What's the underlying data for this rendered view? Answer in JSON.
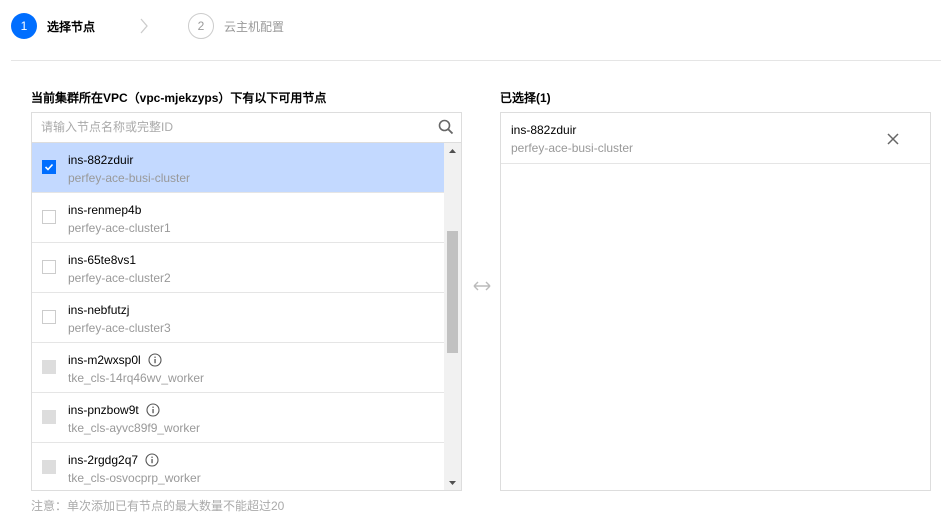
{
  "steps": [
    {
      "number": "1",
      "label": "选择节点",
      "active": true
    },
    {
      "number": "2",
      "label": "云主机配置",
      "active": false
    }
  ],
  "left": {
    "title": "当前集群所在VPC（vpc-mjekzyps）下有以下可用节点",
    "search_placeholder": "请输入节点名称或完整ID",
    "items": [
      {
        "name": "ins-882zduir",
        "sub": "perfey-ace-busi-cluster",
        "state": "checked",
        "info": false
      },
      {
        "name": "ins-renmep4b",
        "sub": "perfey-ace-cluster1",
        "state": "unchecked",
        "info": false
      },
      {
        "name": "ins-65te8vs1",
        "sub": "perfey-ace-cluster2",
        "state": "unchecked",
        "info": false
      },
      {
        "name": "ins-nebfutzj",
        "sub": "perfey-ace-cluster3",
        "state": "unchecked",
        "info": false
      },
      {
        "name": "ins-m2wxsp0l",
        "sub": "tke_cls-14rq46wv_worker",
        "state": "disabled",
        "info": true
      },
      {
        "name": "ins-pnzbow9t",
        "sub": "tke_cls-ayvc89f9_worker",
        "state": "disabled",
        "info": true
      },
      {
        "name": "ins-2rgdg2q7",
        "sub": "tke_cls-osvocprp_worker",
        "state": "disabled",
        "info": true
      }
    ]
  },
  "right": {
    "title": "已选择(1)",
    "items": [
      {
        "name": "ins-882zduir",
        "sub": "perfey-ace-busi-cluster"
      }
    ]
  },
  "note": "注意：单次添加已有节点的最大数量不能超过20",
  "colors": {
    "accent": "#006eff",
    "selected_row": "#c3d9ff"
  }
}
